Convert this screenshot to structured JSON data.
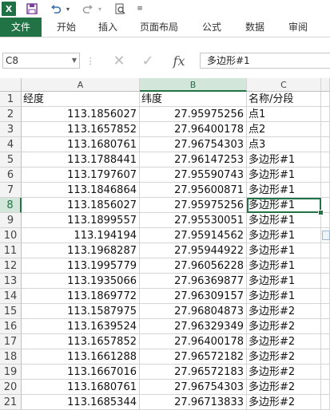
{
  "toolbar": {
    "logo": "X",
    "save_icon": "save-icon",
    "undo_icon": "undo-icon",
    "redo_icon": "redo-icon",
    "preview_icon": "print-preview-icon",
    "customize_icon": "customize-qat-icon"
  },
  "ribbon": {
    "tabs": [
      "文件",
      "开始",
      "插入",
      "页面布局",
      "公式",
      "数据",
      "审阅"
    ]
  },
  "formula_bar": {
    "name_box": "C8",
    "formula": "多边形#1",
    "fx": "fx"
  },
  "grid": {
    "columns": [
      "A",
      "B",
      "C"
    ],
    "selected_column": "C",
    "active_cell": "C8",
    "rows": [
      {
        "n": "1",
        "a": "经度",
        "b": "纬度",
        "c": "名称/分段"
      },
      {
        "n": "2",
        "a": "113.1856027",
        "b": "27.95975256",
        "c": "点1"
      },
      {
        "n": "3",
        "a": "113.1657852",
        "b": "27.96400178",
        "c": "点2"
      },
      {
        "n": "4",
        "a": "113.1680761",
        "b": "27.96754303",
        "c": "点3"
      },
      {
        "n": "5",
        "a": "113.1788441",
        "b": "27.96147253",
        "c": "多边形#1"
      },
      {
        "n": "6",
        "a": "113.1797607",
        "b": "27.95590743",
        "c": "多边形#1"
      },
      {
        "n": "7",
        "a": "113.1846864",
        "b": "27.95600871",
        "c": "多边形#1"
      },
      {
        "n": "8",
        "a": "113.1856027",
        "b": "27.95975256",
        "c": "多边形#1"
      },
      {
        "n": "9",
        "a": "113.1899557",
        "b": "27.95530051",
        "c": "多边形#1"
      },
      {
        "n": "10",
        "a": "113.194194",
        "b": "27.95914562",
        "c": "多边形#1"
      },
      {
        "n": "11",
        "a": "113.1968287",
        "b": "27.95944922",
        "c": "多边形#1"
      },
      {
        "n": "12",
        "a": "113.1995779",
        "b": "27.96056228",
        "c": "多边形#1"
      },
      {
        "n": "13",
        "a": "113.1935066",
        "b": "27.96369877",
        "c": "多边形#1"
      },
      {
        "n": "14",
        "a": "113.1869772",
        "b": "27.96309157",
        "c": "多边形#1"
      },
      {
        "n": "15",
        "a": "113.1587975",
        "b": "27.96804873",
        "c": "多边形#2"
      },
      {
        "n": "16",
        "a": "113.1639524",
        "b": "27.96329349",
        "c": "多边形#2"
      },
      {
        "n": "17",
        "a": "113.1657852",
        "b": "27.96400178",
        "c": "多边形#2"
      },
      {
        "n": "18",
        "a": "113.1661288",
        "b": "27.96572182",
        "c": "多边形#2"
      },
      {
        "n": "19",
        "a": "113.1667016",
        "b": "27.96572183",
        "c": "多边形#2"
      },
      {
        "n": "20",
        "a": "113.1680761",
        "b": "27.96754303",
        "c": "多边形#2"
      },
      {
        "n": "21",
        "a": "113.1685344",
        "b": "27.96713833",
        "c": "多边形#2"
      }
    ]
  }
}
